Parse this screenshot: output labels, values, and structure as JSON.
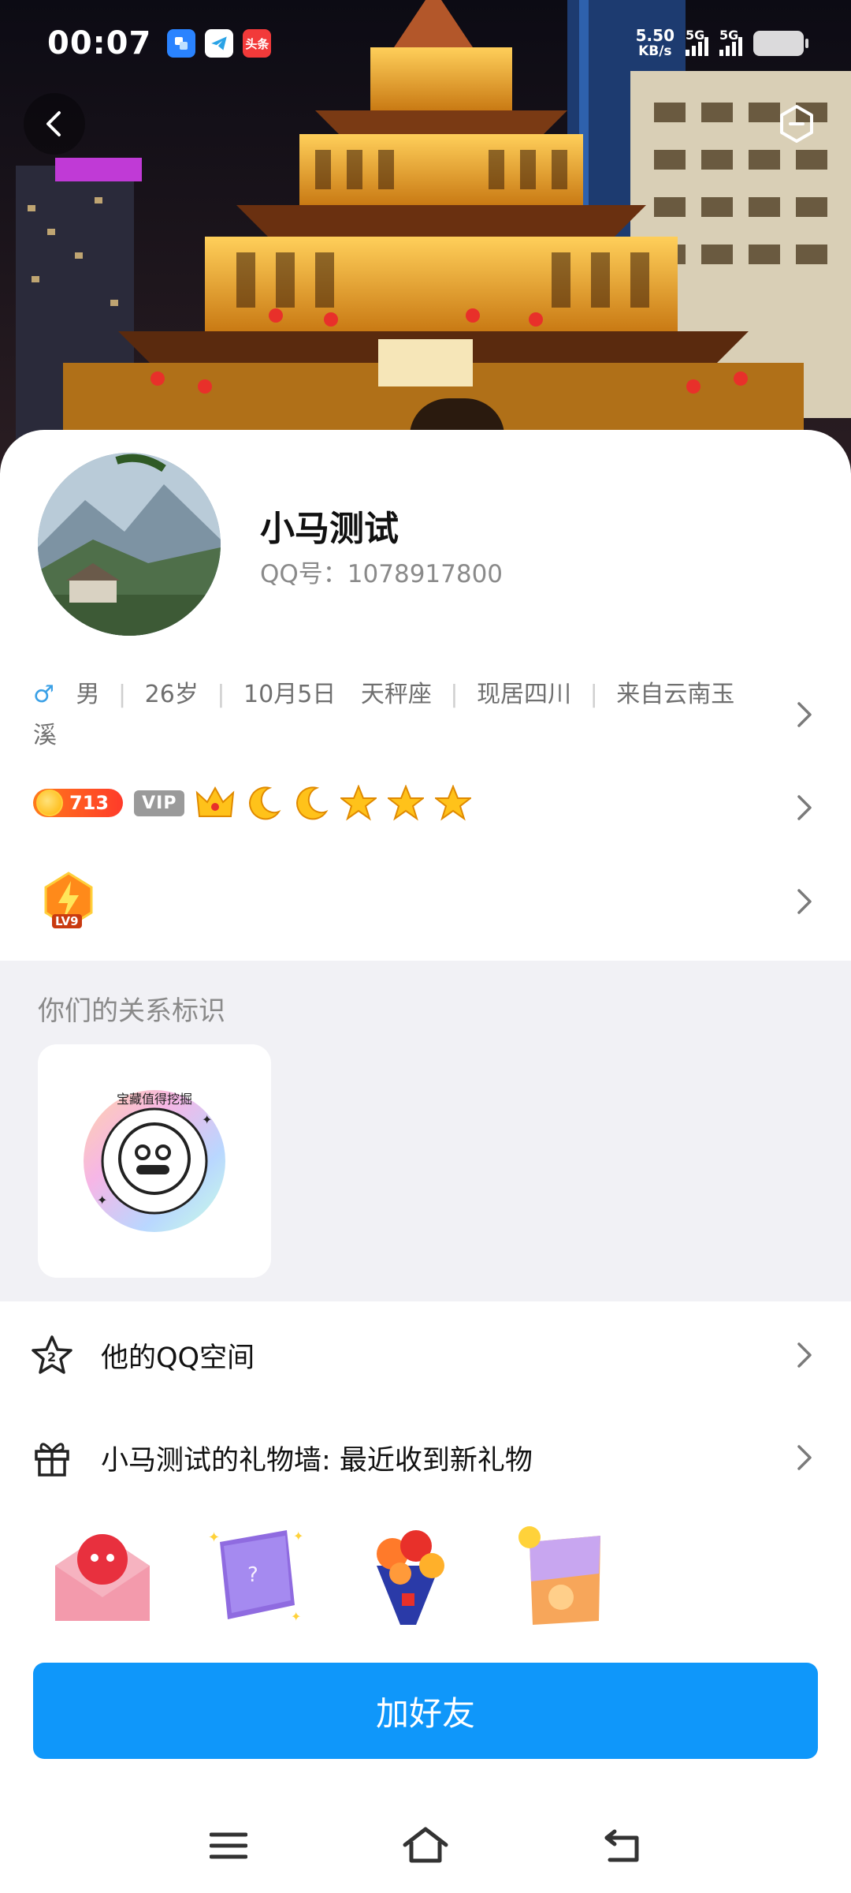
{
  "status_bar": {
    "time": "00:07",
    "net_speed_value": "5.50",
    "net_speed_unit": "KB/s",
    "signal1_label": "5G",
    "signal2_label": "5G",
    "app_icons": [
      "tim-icon",
      "telegram-icon",
      "toutiao-icon"
    ],
    "toutiao_label": "头条"
  },
  "profile": {
    "name": "小马测试",
    "qq_number": "QQ号：1078917800",
    "gender_symbol": "♂",
    "gender": "男",
    "age": "26岁",
    "birthday": "10月5日",
    "zodiac": "天秤座",
    "residence": "现居四川",
    "hometown": "来自云南玉溪"
  },
  "badges": {
    "coin_value": "713",
    "vip_label": "VIP",
    "level_icons": [
      "crown-icon",
      "moon-icon",
      "moon-icon",
      "star-icon",
      "star-icon",
      "star-icon"
    ],
    "lv_label": "LV9"
  },
  "relation": {
    "title": "你们的关系标识",
    "badge_text": "宝藏值得挖掘"
  },
  "list": {
    "qzone_label": "他的QQ空间",
    "gift_wall_label": "小马测试的礼物墙: 最近收到新礼物"
  },
  "gifts": [
    "envelope-gift",
    "magic-book-gift",
    "bouquet-gift",
    "dessert-gift"
  ],
  "actions": {
    "add_friend": "加好友"
  },
  "colors": {
    "primary_button": "#0f97fa",
    "male_blue": "#3aa0e6",
    "coin_orange": "#ff5a22",
    "section_bg": "#f1f1f5"
  }
}
